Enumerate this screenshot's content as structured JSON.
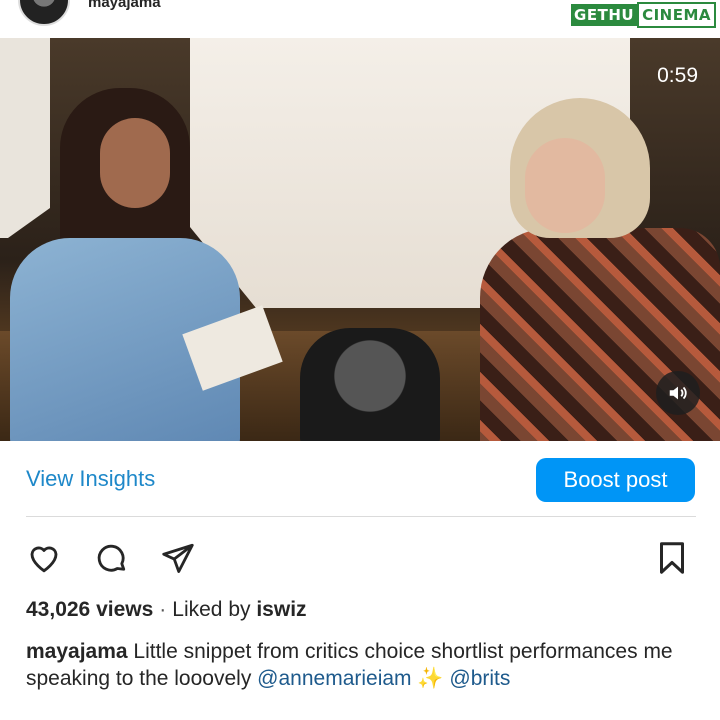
{
  "header": {
    "username": "mayajama",
    "watermark_left": "GETHU",
    "watermark_right": "CINEMA"
  },
  "video": {
    "time_remaining": "0:59",
    "mute_icon": "speaker-icon"
  },
  "insights": {
    "view_insights_label": "View Insights",
    "boost_label": "Boost post"
  },
  "actions": {
    "icons": [
      "heart-icon",
      "comment-icon",
      "share-icon",
      "bookmark-icon"
    ]
  },
  "stats": {
    "views": "43,026 views",
    "separator": "·",
    "liked_by_prefix": "Liked by",
    "liked_by_user": "iswiz"
  },
  "caption": {
    "username": "mayajama",
    "text": "Little snippet from critics choice shortlist performances me speaking to the looovely",
    "mention1": "@annemarieiam",
    "sparkles": "✨",
    "mention2": "@brits"
  },
  "colors": {
    "link_blue": "#1e88c9",
    "boost_blue": "#0095f6",
    "mention_blue": "#1e5a8c"
  }
}
